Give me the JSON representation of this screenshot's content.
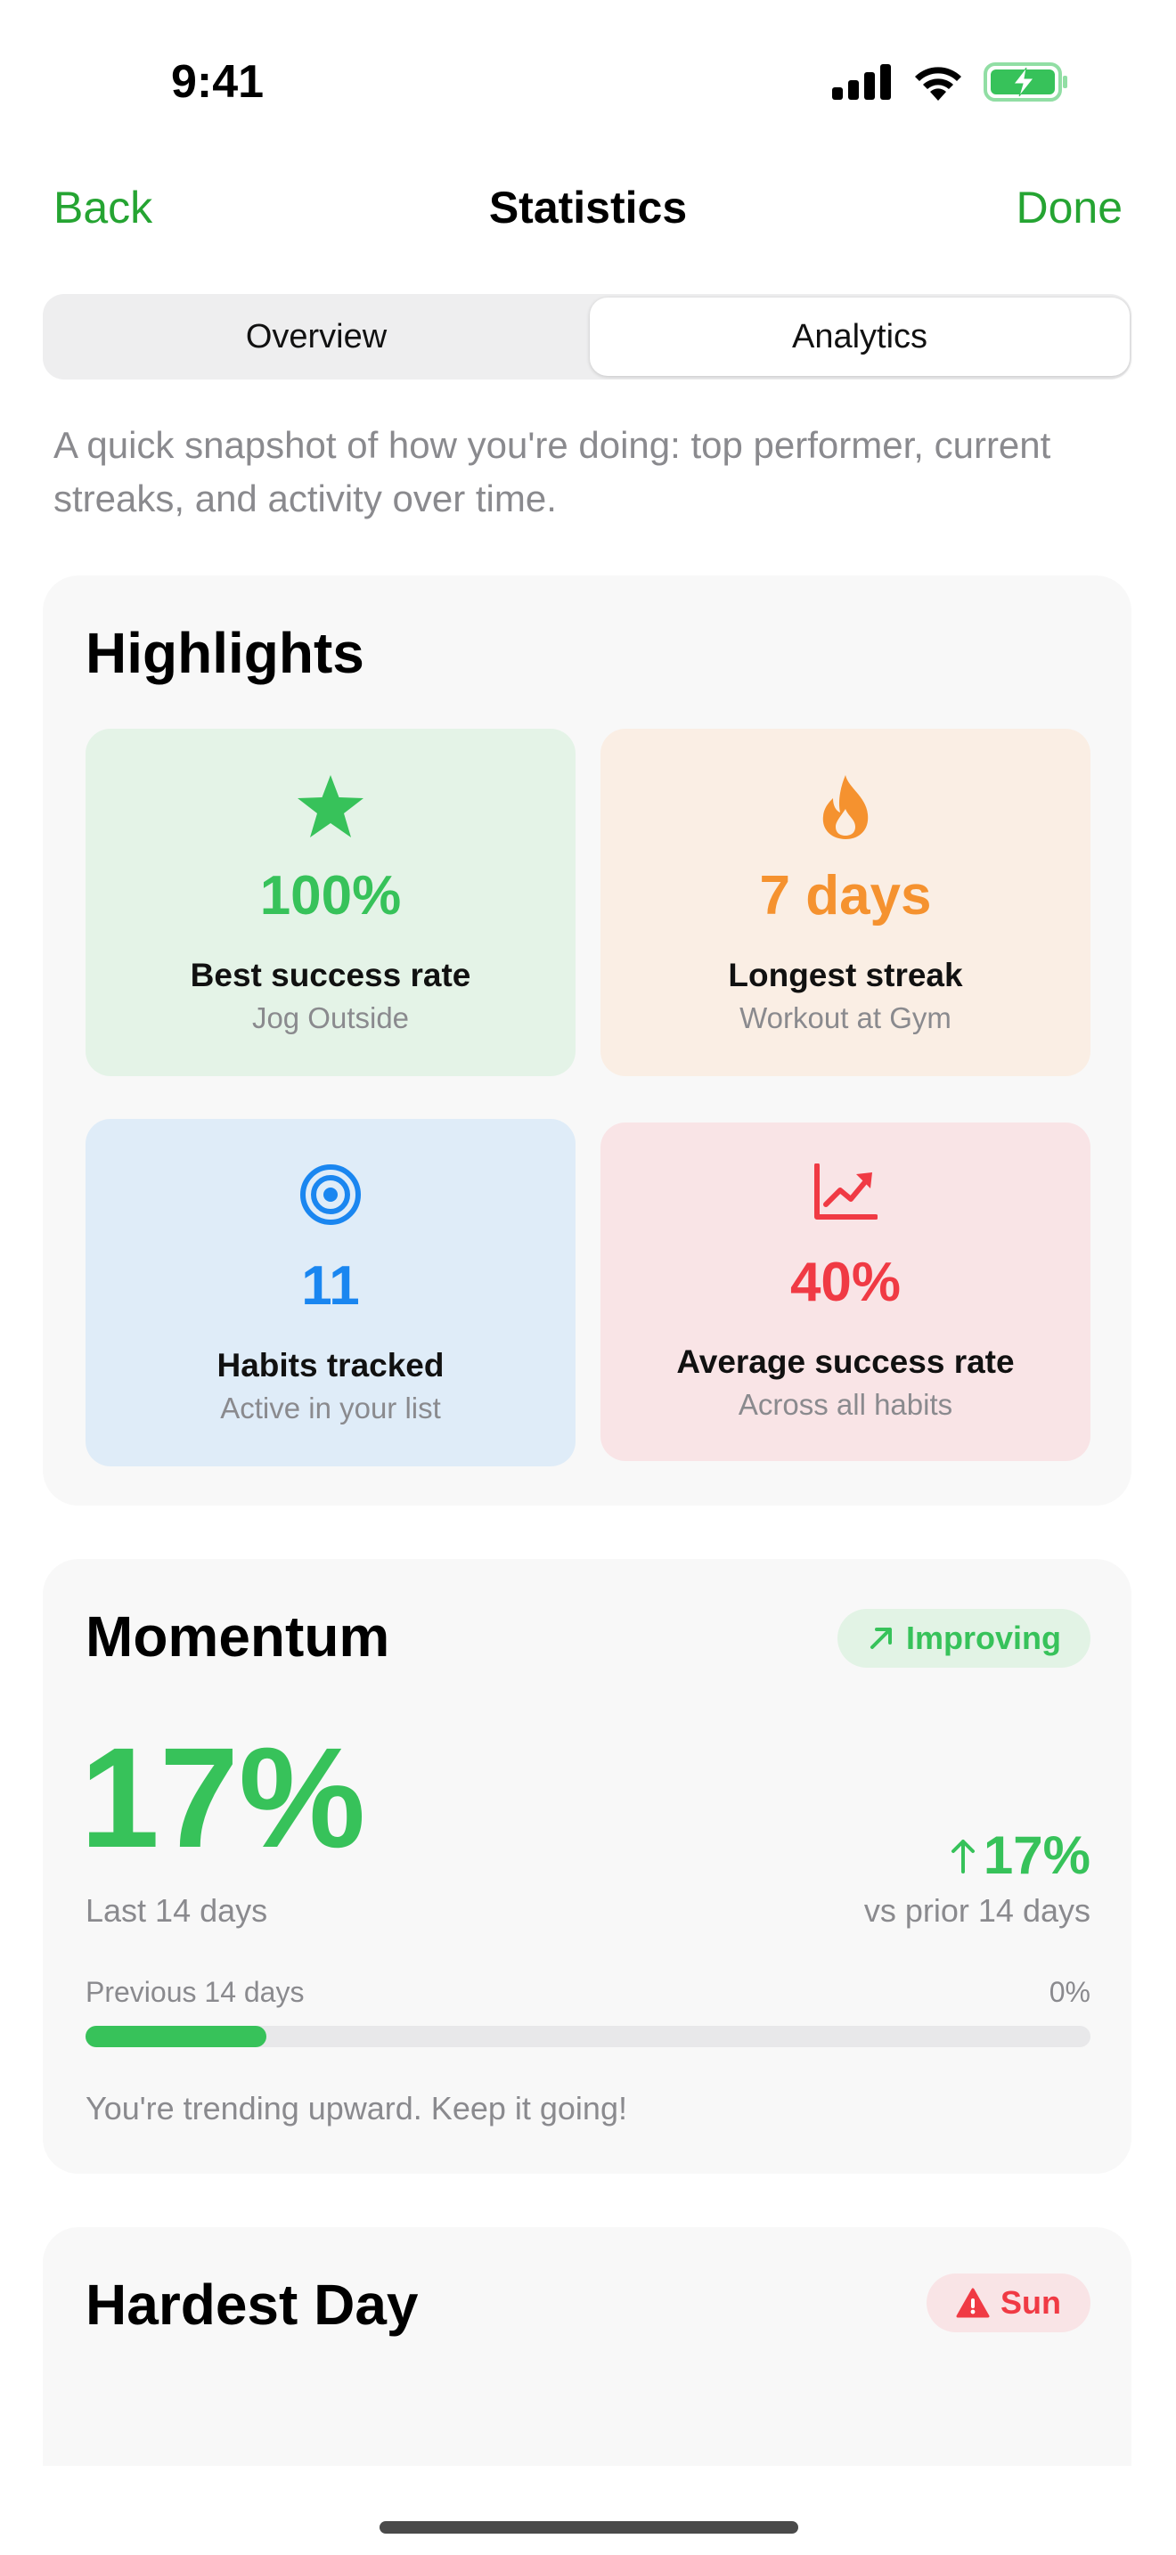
{
  "status_bar": {
    "time": "9:41",
    "icons": [
      "signal-icon",
      "wifi-icon",
      "battery-charging-icon"
    ]
  },
  "nav": {
    "back_label": "Back",
    "title": "Statistics",
    "done_label": "Done"
  },
  "tabs": [
    {
      "label": "Overview",
      "selected": false
    },
    {
      "label": "Analytics",
      "selected": true
    }
  ],
  "intro_text": "A quick snapshot of how you're doing: top performer, current streaks, and activity over time.",
  "highlights": {
    "title": "Highlights",
    "tiles": [
      {
        "icon": "star-icon",
        "value": "100%",
        "label": "Best success rate",
        "sub": "Jog Outside",
        "color": "#37c25a",
        "bg": "#e4f3e7"
      },
      {
        "icon": "flame-icon",
        "value": "7 days",
        "label": "Longest streak",
        "sub": "Workout at Gym",
        "color": "#f5922f",
        "bg": "#faeee4"
      },
      {
        "icon": "target-icon",
        "value": "11",
        "label": "Habits tracked",
        "sub": "Active in your list",
        "color": "#1a86f0",
        "bg": "#dfecf8"
      },
      {
        "icon": "chart-trend-up-icon",
        "value": "40%",
        "label": "Average success rate",
        "sub": "Across all habits",
        "color": "#f03a44",
        "bg": "#f9e4e6"
      }
    ]
  },
  "momentum": {
    "title": "Momentum",
    "badge": {
      "icon": "arrow-up-right-icon",
      "label": "Improving",
      "color": "#37c25a",
      "bg": "#e2f3e5"
    },
    "value": "17%",
    "value_caption": "Last 14 days",
    "delta": "17%",
    "delta_icon": "arrow-up-icon",
    "delta_caption": "vs prior 14 days",
    "previous_label": "Previous 14 days",
    "previous_value": "0%",
    "progress_fraction": 0.18,
    "message": "You're trending upward. Keep it going!"
  },
  "hardest_day": {
    "title": "Hardest Day",
    "badge": {
      "icon": "warning-icon",
      "label": "Sun",
      "color": "#f03a44",
      "bg": "#f9e4e6"
    }
  }
}
